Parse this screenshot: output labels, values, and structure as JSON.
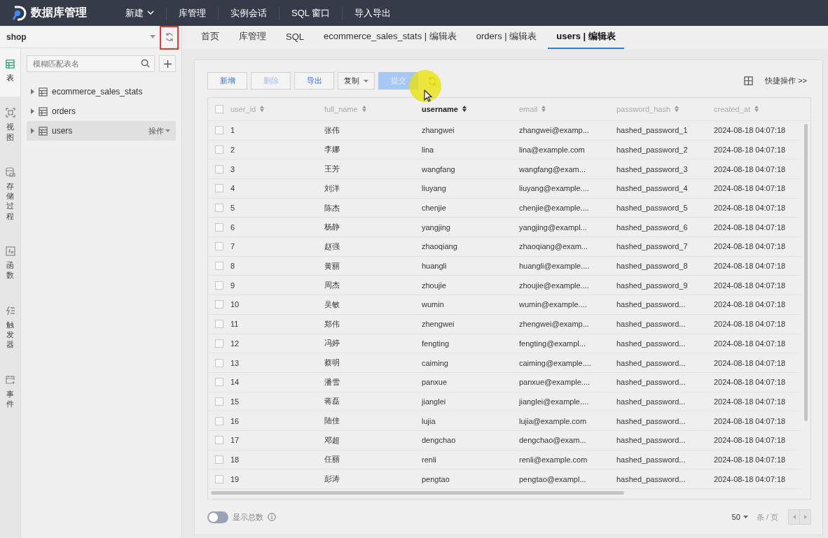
{
  "app": {
    "title": "数据库管理"
  },
  "menu": [
    {
      "label": "新建",
      "kind": "dropdown"
    },
    {
      "label": "库管理",
      "kind": "plain"
    },
    {
      "label": "实例会话",
      "kind": "plain"
    },
    {
      "label": "SQL 窗口",
      "kind": "plain"
    },
    {
      "label": "导入导出",
      "kind": "plain"
    }
  ],
  "database": {
    "name": "shop"
  },
  "rail": [
    {
      "label": "表",
      "kind": "table",
      "selected": true
    },
    {
      "label": "视图",
      "kind": "view",
      "selected": false
    },
    {
      "label": "存储过程",
      "kind": "procedure",
      "selected": false
    },
    {
      "label": "函数",
      "kind": "function",
      "selected": false
    },
    {
      "label": "触发器",
      "kind": "trigger",
      "selected": false
    },
    {
      "label": "事件",
      "kind": "event",
      "selected": false
    }
  ],
  "search": {
    "placeholder": "模糊匹配表名"
  },
  "tree": [
    {
      "name": "ecommerce_sales_stats",
      "selected": false
    },
    {
      "name": "orders",
      "selected": false
    },
    {
      "name": "users",
      "selected": true,
      "action": "操作"
    }
  ],
  "tabs": [
    {
      "label": "首页",
      "selected": false
    },
    {
      "label": "库管理",
      "selected": false
    },
    {
      "label": "SQL",
      "selected": false
    },
    {
      "label": "ecommerce_sales_stats | 编辑表",
      "selected": false
    },
    {
      "label": "orders | 编辑表",
      "selected": false
    },
    {
      "label": "users | 编辑表",
      "selected": true
    }
  ],
  "toolbar": [
    {
      "label": "新增",
      "kind": "link",
      "disabled": false
    },
    {
      "label": "删除",
      "kind": "link",
      "disabled": true
    },
    {
      "label": "导出",
      "kind": "link",
      "disabled": false
    },
    {
      "label": "复制",
      "kind": "dropdown",
      "disabled": false
    },
    {
      "label": "提交",
      "kind": "primary",
      "disabled": true
    }
  ],
  "quick_actions": "快捷操作 >>",
  "table": {
    "all_checked": false,
    "columns": [
      {
        "label": "user_id",
        "active": false
      },
      {
        "label": "full_name",
        "active": false
      },
      {
        "label": "username",
        "active": true
      },
      {
        "label": "email",
        "active": false
      },
      {
        "label": "password_hash",
        "active": false
      },
      {
        "label": "created_at",
        "active": false
      }
    ],
    "rows": [
      {
        "checked": false,
        "cells": [
          "1",
          "张伟",
          "zhangwei",
          "zhangwei@examp...",
          "hashed_password_1",
          "2024-08-18 04:07:18"
        ]
      },
      {
        "checked": false,
        "cells": [
          "2",
          "李娜",
          "lina",
          "lina@example.com",
          "hashed_password_2",
          "2024-08-18 04:07:18"
        ]
      },
      {
        "checked": false,
        "cells": [
          "3",
          "王芳",
          "wangfang",
          "wangfang@exam...",
          "hashed_password_3",
          "2024-08-18 04:07:18"
        ]
      },
      {
        "checked": false,
        "cells": [
          "4",
          "刘洋",
          "liuyang",
          "liuyang@example....",
          "hashed_password_4",
          "2024-08-18 04:07:18"
        ]
      },
      {
        "checked": false,
        "cells": [
          "5",
          "陈杰",
          "chenjie",
          "chenjie@example....",
          "hashed_password_5",
          "2024-08-18 04:07:18"
        ]
      },
      {
        "checked": false,
        "cells": [
          "6",
          "杨静",
          "yangjing",
          "yangjing@exampl...",
          "hashed_password_6",
          "2024-08-18 04:07:18"
        ]
      },
      {
        "checked": false,
        "cells": [
          "7",
          "赵强",
          "zhaoqiang",
          "zhaoqiang@exam...",
          "hashed_password_7",
          "2024-08-18 04:07:18"
        ]
      },
      {
        "checked": false,
        "cells": [
          "8",
          "黄丽",
          "huangli",
          "huangli@example....",
          "hashed_password_8",
          "2024-08-18 04:07:18"
        ]
      },
      {
        "checked": false,
        "cells": [
          "9",
          "周杰",
          "zhoujie",
          "zhoujie@example....",
          "hashed_password_9",
          "2024-08-18 04:07:18"
        ]
      },
      {
        "checked": false,
        "cells": [
          "10",
          "吴敏",
          "wumin",
          "wumin@example....",
          "hashed_password...",
          "2024-08-18 04:07:18"
        ]
      },
      {
        "checked": false,
        "cells": [
          "11",
          "郑伟",
          "zhengwei",
          "zhengwei@examp...",
          "hashed_password...",
          "2024-08-18 04:07:18"
        ]
      },
      {
        "checked": false,
        "cells": [
          "12",
          "冯婷",
          "fengting",
          "fengting@exampl...",
          "hashed_password...",
          "2024-08-18 04:07:18"
        ]
      },
      {
        "checked": false,
        "cells": [
          "13",
          "蔡明",
          "caiming",
          "caiming@example....",
          "hashed_password...",
          "2024-08-18 04:07:18"
        ]
      },
      {
        "checked": false,
        "cells": [
          "14",
          "潘雪",
          "panxue",
          "panxue@example....",
          "hashed_password...",
          "2024-08-18 04:07:18"
        ]
      },
      {
        "checked": false,
        "cells": [
          "15",
          "蒋磊",
          "jianglei",
          "jianglei@example....",
          "hashed_password...",
          "2024-08-18 04:07:18"
        ]
      },
      {
        "checked": false,
        "cells": [
          "16",
          "陆佳",
          "lujia",
          "lujia@example.com",
          "hashed_password...",
          "2024-08-18 04:07:18"
        ]
      },
      {
        "checked": false,
        "cells": [
          "17",
          "邓超",
          "dengchao",
          "dengchao@exam...",
          "hashed_password...",
          "2024-08-18 04:07:18"
        ]
      },
      {
        "checked": false,
        "cells": [
          "18",
          "任丽",
          "renli",
          "renli@example.com",
          "hashed_password...",
          "2024-08-18 04:07:18"
        ]
      },
      {
        "checked": false,
        "cells": [
          "19",
          "彭涛",
          "pengtao",
          "pengtao@exampl...",
          "hashed_password...",
          "2024-08-18 04:07:18"
        ]
      }
    ]
  },
  "footer": {
    "show_total": {
      "label": "显示总数",
      "on": false
    },
    "page_size": "50",
    "per_page": "条 / 页"
  }
}
